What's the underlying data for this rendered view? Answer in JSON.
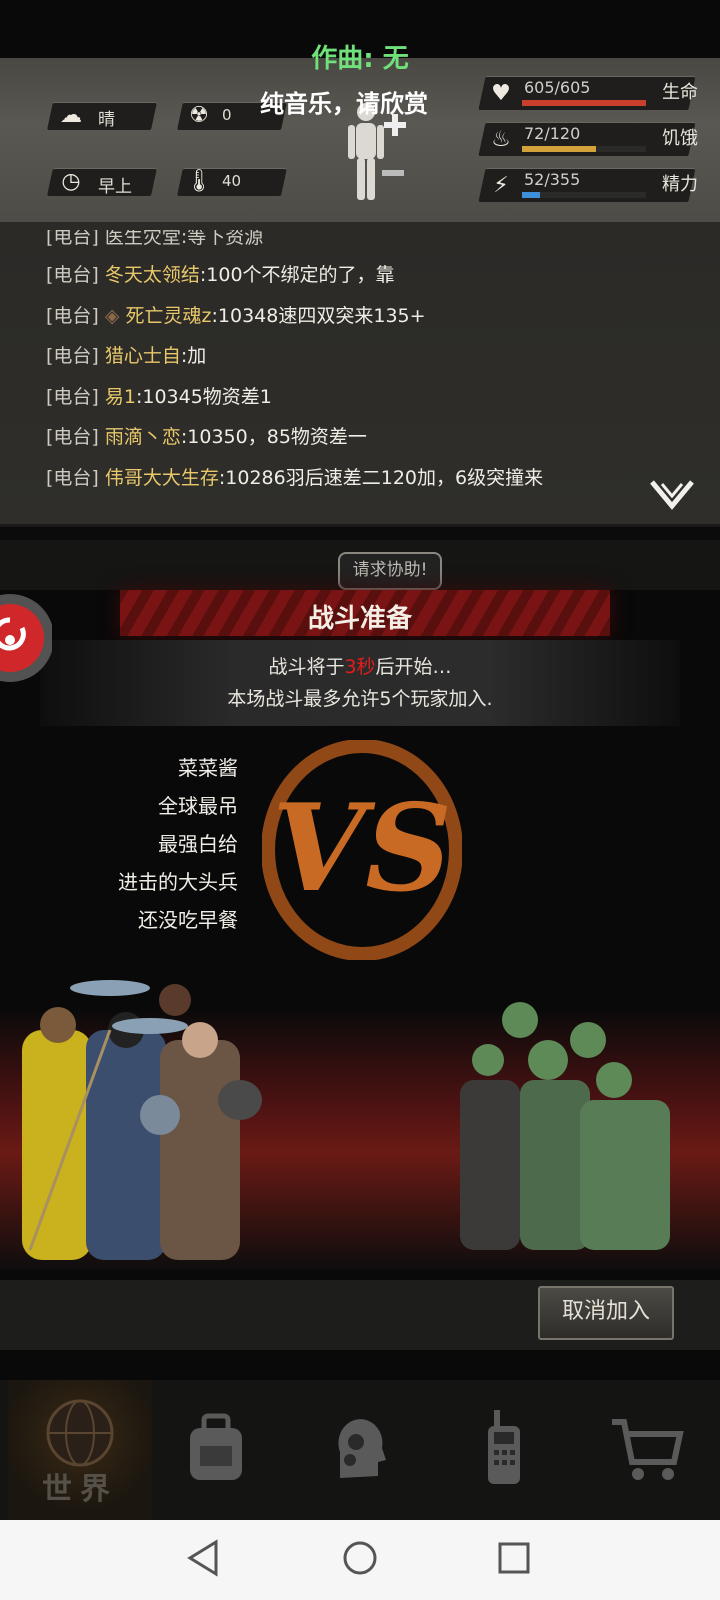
{
  "music": {
    "composer": "作曲: 无",
    "note": "纯音乐，请欣赏"
  },
  "hud": {
    "weather": {
      "icon": "cloud-sun-icon",
      "label": "晴"
    },
    "radiation": {
      "icon": "radiation-icon",
      "value": "0"
    },
    "time_of_day": {
      "icon": "clock-icon",
      "label": "早上"
    },
    "temperature": {
      "icon": "thermometer-icon",
      "value": "40"
    },
    "stats": [
      {
        "icon": "heart-pulse-icon",
        "value": "605/605",
        "label": "生命",
        "fraction": 1.0,
        "color": "#c8402c"
      },
      {
        "icon": "stomach-icon",
        "value": "72/120",
        "label": "饥饿",
        "fraction": 0.6,
        "color": "#d4a23a"
      },
      {
        "icon": "energy-head-icon",
        "value": "52/355",
        "label": "精力",
        "fraction": 0.146,
        "color": "#3c8fd8"
      }
    ]
  },
  "chat": {
    "partial_line": "[电台] 医生灾堂:等下资源",
    "lines": [
      {
        "tag": "[电台]",
        "name": "冬天太领结",
        "msg": ":100个不绑定的了，靠"
      },
      {
        "tag": "[电台]",
        "name": "死亡灵魂z",
        "msg": ":10348速四双突来135+"
      },
      {
        "tag": "[电台]",
        "name": "猎心士自",
        "msg": ":加"
      },
      {
        "tag": "[电台]",
        "name": "易1",
        "msg": ":10345物资差1"
      },
      {
        "tag": "[电台]",
        "name": "雨滴丶恋",
        "msg": ":10350，85物资差一"
      },
      {
        "tag": "[电台]",
        "name": "伟哥大大生存",
        "msg": ":10286羽后速差二120加，6级突撞来"
      }
    ]
  },
  "under": {
    "help_label": "请求协助!"
  },
  "dialog": {
    "title": "战斗准备",
    "countdown_prefix": "战斗将于",
    "countdown_value": "3秒",
    "countdown_suffix": "后开始…",
    "limit_text": "本场战斗最多允许5个玩家加入.",
    "players": [
      "菜菜酱",
      "全球最吊",
      "最强白给",
      "进击的大头兵",
      "还没吃早餐"
    ],
    "vs_text": "VS",
    "cancel_label": "取消加入"
  },
  "bottom_nav": [
    {
      "icon": "globe-icon",
      "label": "世界",
      "active": true
    },
    {
      "icon": "backpack-icon",
      "label": "",
      "active": false
    },
    {
      "icon": "head-gear-icon",
      "label": "",
      "active": false
    },
    {
      "icon": "walkie-talkie-icon",
      "label": "",
      "active": false
    },
    {
      "icon": "cart-icon",
      "label": "",
      "active": false
    }
  ],
  "system_nav": {
    "back": "back-triangle-icon",
    "home": "home-circle-icon",
    "recents": "recents-square-icon"
  }
}
